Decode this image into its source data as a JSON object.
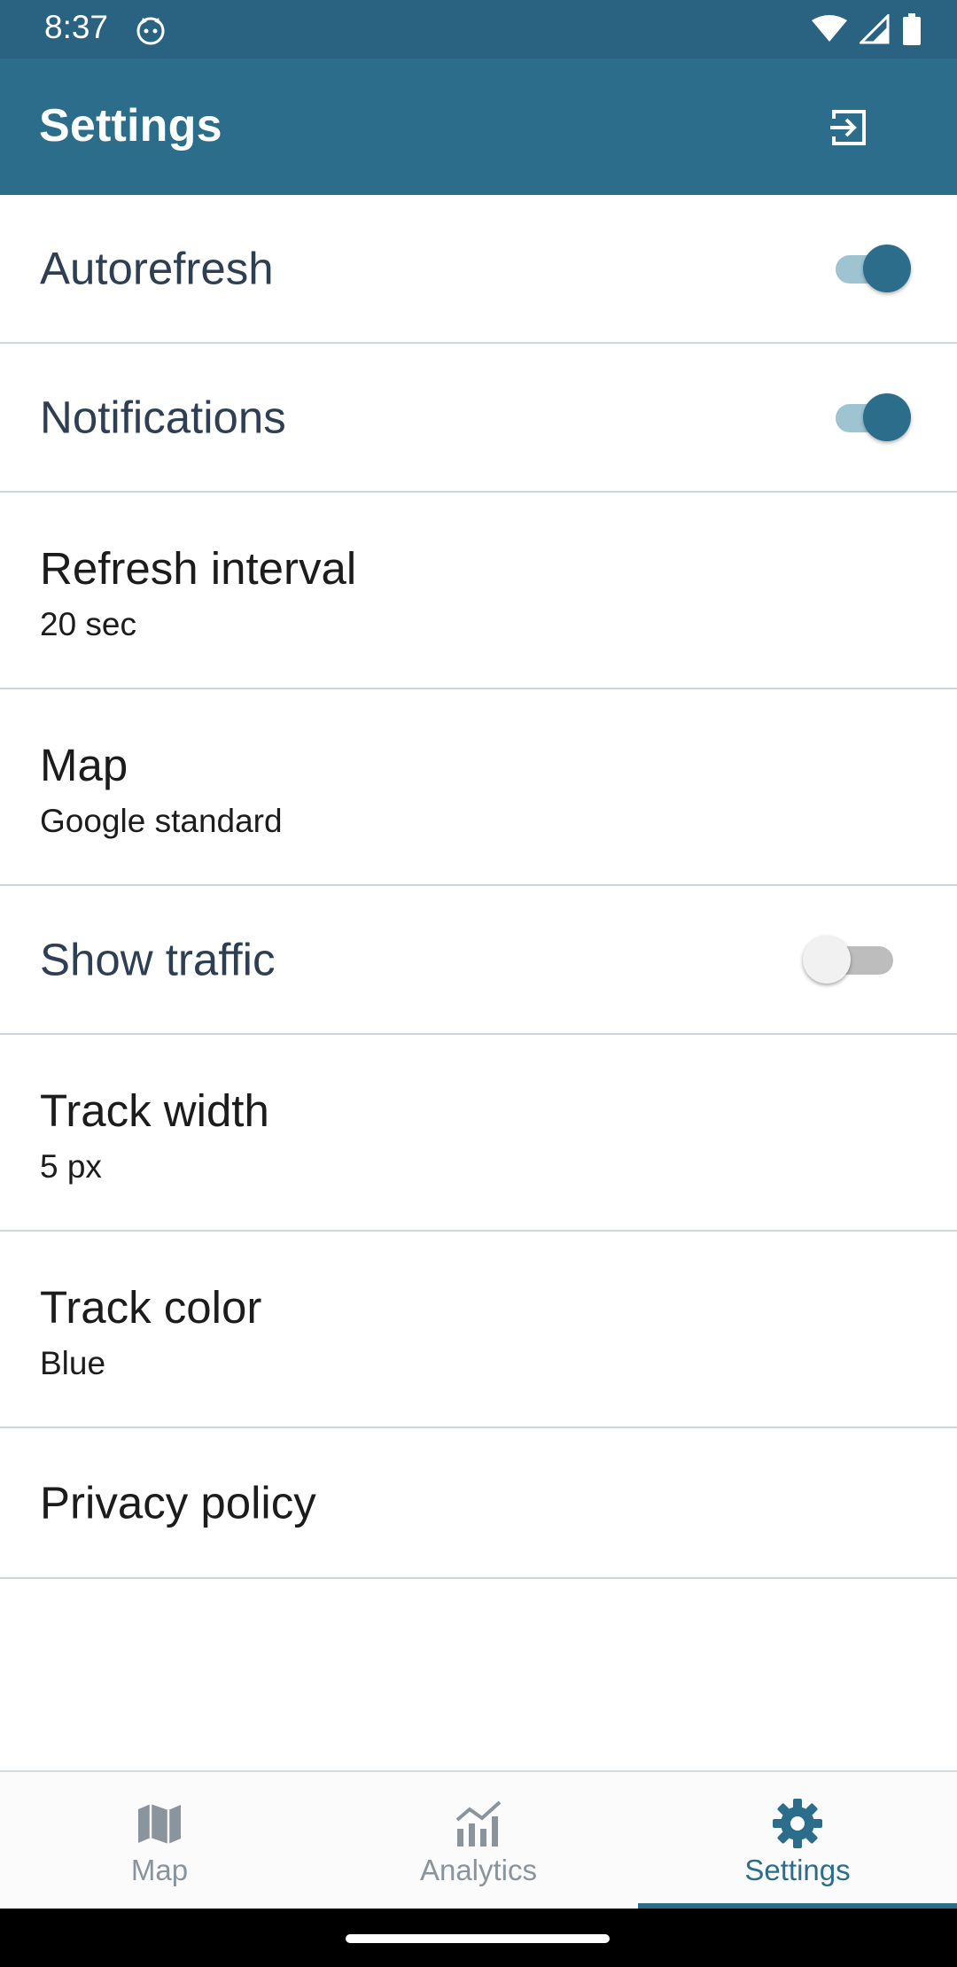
{
  "status": {
    "time": "8:37"
  },
  "appbar": {
    "title": "Settings"
  },
  "settings": {
    "autorefresh": {
      "label": "Autorefresh",
      "enabled": true
    },
    "notifications": {
      "label": "Notifications",
      "enabled": true
    },
    "refresh_interval": {
      "label": "Refresh interval",
      "value": "20 sec"
    },
    "map": {
      "label": "Map",
      "value": "Google standard"
    },
    "show_traffic": {
      "label": "Show traffic",
      "enabled": false
    },
    "track_width": {
      "label": "Track width",
      "value": "5 px"
    },
    "track_color": {
      "label": "Track color",
      "value": "Blue"
    },
    "privacy_policy": {
      "label": "Privacy policy"
    }
  },
  "nav": {
    "items": [
      {
        "label": "Map",
        "icon": "map-icon",
        "active": false
      },
      {
        "label": "Analytics",
        "icon": "analytics-icon",
        "active": false
      },
      {
        "label": "Settings",
        "icon": "gear-icon",
        "active": true
      }
    ]
  },
  "colors": {
    "primary": "#2b6d8a",
    "status_bar": "#2a6381",
    "text_slate": "#2e3f53",
    "inactive": "#8a949d"
  }
}
